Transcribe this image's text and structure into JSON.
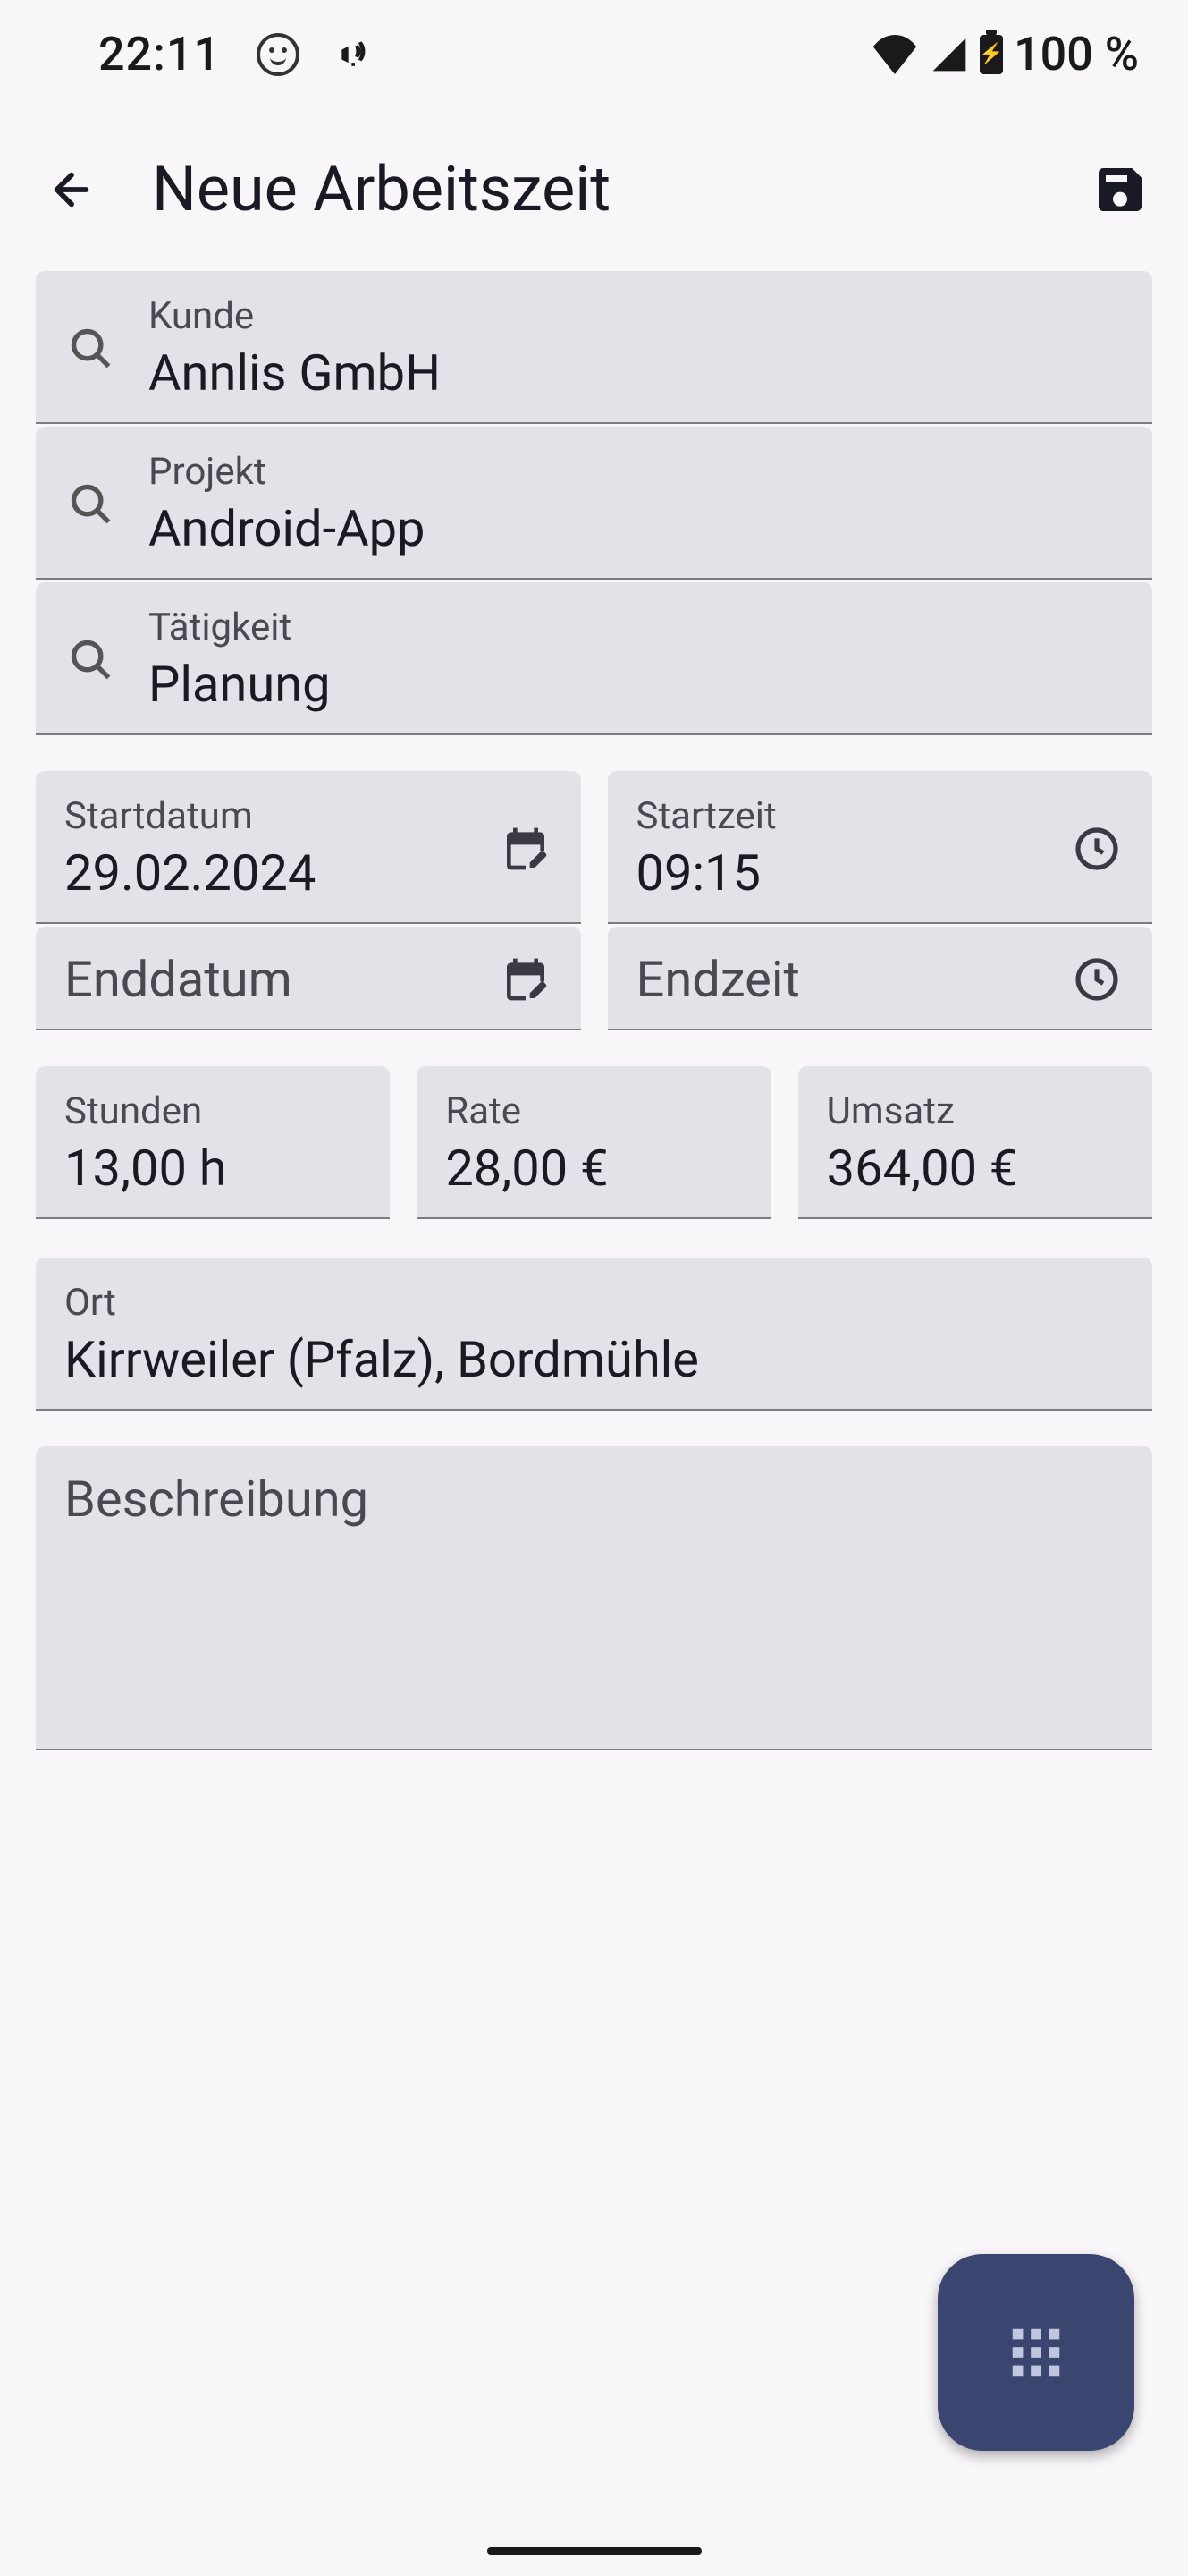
{
  "status": {
    "time": "22:11",
    "battery": "100 %"
  },
  "header": {
    "title": "Neue Arbeitszeit"
  },
  "fields": {
    "customer_label": "Kunde",
    "customer_value": "Annlis GmbH",
    "project_label": "Projekt",
    "project_value": "Android-App",
    "activity_label": "Tätigkeit",
    "activity_value": "Planung",
    "startdate_label": "Startdatum",
    "startdate_value": "29.02.2024",
    "starttime_label": "Startzeit",
    "starttime_value": "09:15",
    "enddate_label": "Enddatum",
    "enddate_value": "",
    "endtime_label": "Endzeit",
    "endtime_value": "",
    "hours_label": "Stunden",
    "hours_value": "13,00 h",
    "rate_label": "Rate",
    "rate_value": "28,00 €",
    "revenue_label": "Umsatz",
    "revenue_value": "364,00 €",
    "location_label": "Ort",
    "location_value": "Kirrweiler (Pfalz), Bordmühle",
    "description_label": "Beschreibung",
    "description_value": ""
  }
}
